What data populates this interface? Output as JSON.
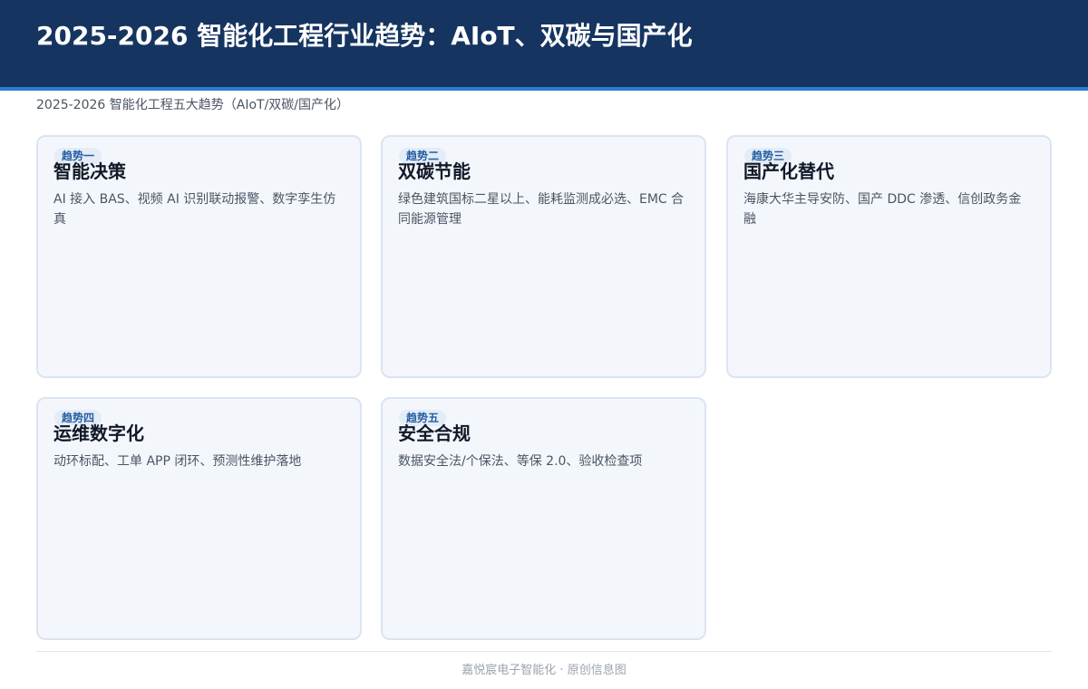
{
  "header": {
    "title": "2025-2026 智能化工程行业趋势：AIoT、双碳与国产化"
  },
  "subtitle": "2025-2026 智能化工程五大趋势（AIoT/双碳/国产化）",
  "cards": [
    {
      "badge": "趋势一",
      "title": "智能决策",
      "text": "AI 接入 BAS、视频 AI 识别联动报警、数字孪生仿真"
    },
    {
      "badge": "趋势二",
      "title": "双碳节能",
      "text": "绿色建筑国标二星以上、能耗监测成必选、EMC 合同能源管理"
    },
    {
      "badge": "趋势三",
      "title": "国产化替代",
      "text": "海康大华主导安防、国产 DDC 渗透、信创政务金融"
    },
    {
      "badge": "趋势四",
      "title": "运维数字化",
      "text": "动环标配、工单 APP 闭环、预测性维护落地"
    },
    {
      "badge": "趋势五",
      "title": "安全合规",
      "text": "数据安全法/个保法、等保 2.0、验收检查项"
    }
  ],
  "footer": "嘉悦宸电子智能化 · 原创信息图",
  "colors": {
    "header_background": "#163460",
    "header_accent": "#2f7ad1",
    "card_background": "#f3f7fc",
    "card_border": "#dbe4f0",
    "badge_text": "#245d9f"
  }
}
